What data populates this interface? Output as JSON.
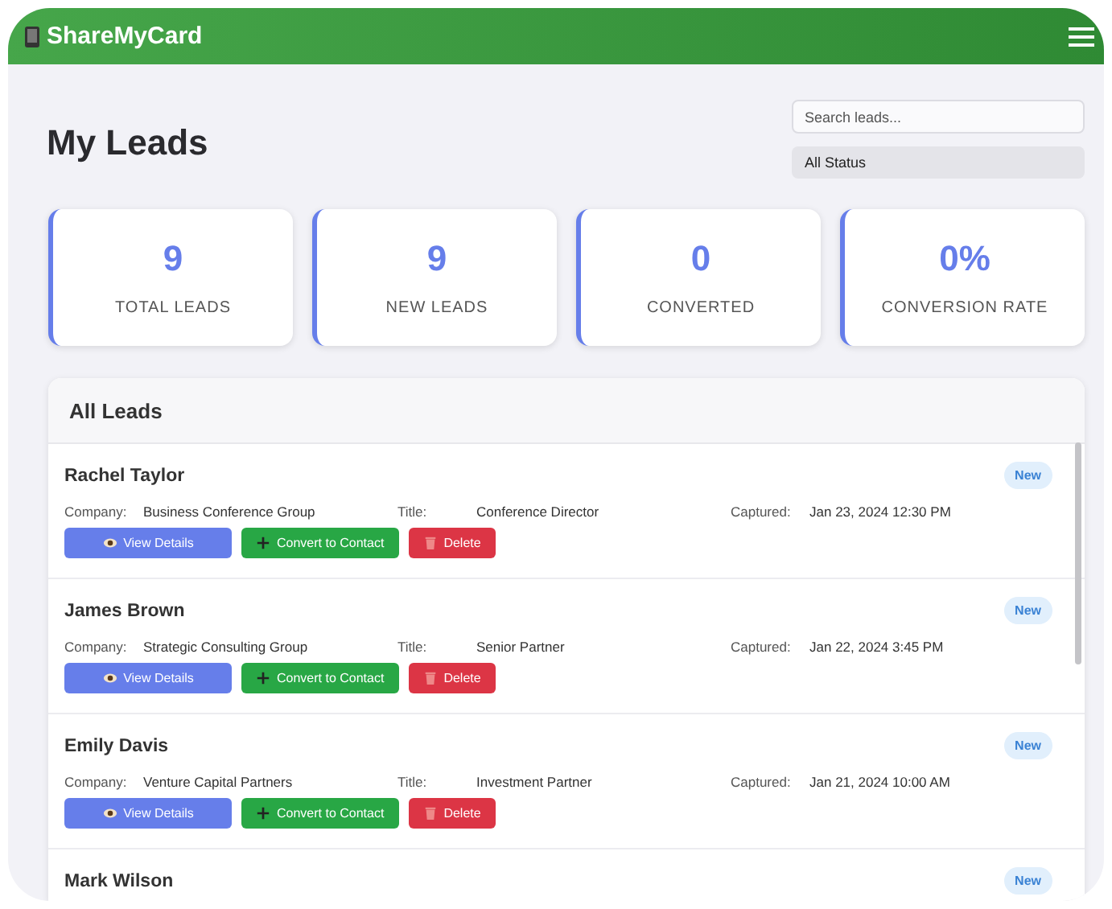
{
  "app_bar": {
    "brand": "ShareMyCard"
  },
  "page": {
    "title": "My Leads"
  },
  "search": {
    "placeholder": "Search leads..."
  },
  "status_filter": {
    "value": "All Status"
  },
  "stats": [
    {
      "value": "9",
      "label": "TOTAL LEADS"
    },
    {
      "value": "9",
      "label": "NEW LEADS"
    },
    {
      "value": "0",
      "label": "CONVERTED"
    },
    {
      "value": "0%",
      "label": "CONVERSION RATE"
    }
  ],
  "leads_panel": {
    "title": "All Leads",
    "leads": [
      {
        "name": "Rachel Taylor",
        "status": "New",
        "details": [
          {
            "label": "Company:",
            "value": "Business Conference Group"
          },
          {
            "label": "Title:",
            "value": "Conference Director"
          },
          {
            "label": "Captured:",
            "value": "Jan 23, 2024 12:30 PM"
          }
        ],
        "actions": [
          {
            "kind": "view",
            "label": "View Details"
          },
          {
            "kind": "convert",
            "label": "Convert to Contact"
          },
          {
            "kind": "delete",
            "label": "Delete"
          }
        ]
      },
      {
        "name": "James Brown",
        "status": "New",
        "details": [
          {
            "label": "Company:",
            "value": "Strategic Consulting Group"
          },
          {
            "label": "Title:",
            "value": "Senior Partner"
          },
          {
            "label": "Captured:",
            "value": "Jan 22, 2024 3:45 PM"
          }
        ],
        "actions": [
          {
            "kind": "view",
            "label": "View Details"
          },
          {
            "kind": "convert",
            "label": "Convert to Contact"
          },
          {
            "kind": "delete",
            "label": "Delete"
          }
        ]
      },
      {
        "name": "Emily Davis",
        "status": "New",
        "details": [
          {
            "label": "Company:",
            "value": "Venture Capital Partners"
          },
          {
            "label": "Title:",
            "value": "Investment Partner"
          },
          {
            "label": "Captured:",
            "value": "Jan 21, 2024 10:00 AM"
          }
        ],
        "actions": [
          {
            "kind": "view",
            "label": "View Details"
          },
          {
            "kind": "convert",
            "label": "Convert to Contact"
          },
          {
            "kind": "delete",
            "label": "Delete"
          }
        ]
      },
      {
        "name": "Mark Wilson",
        "status": "New"
      }
    ]
  }
}
